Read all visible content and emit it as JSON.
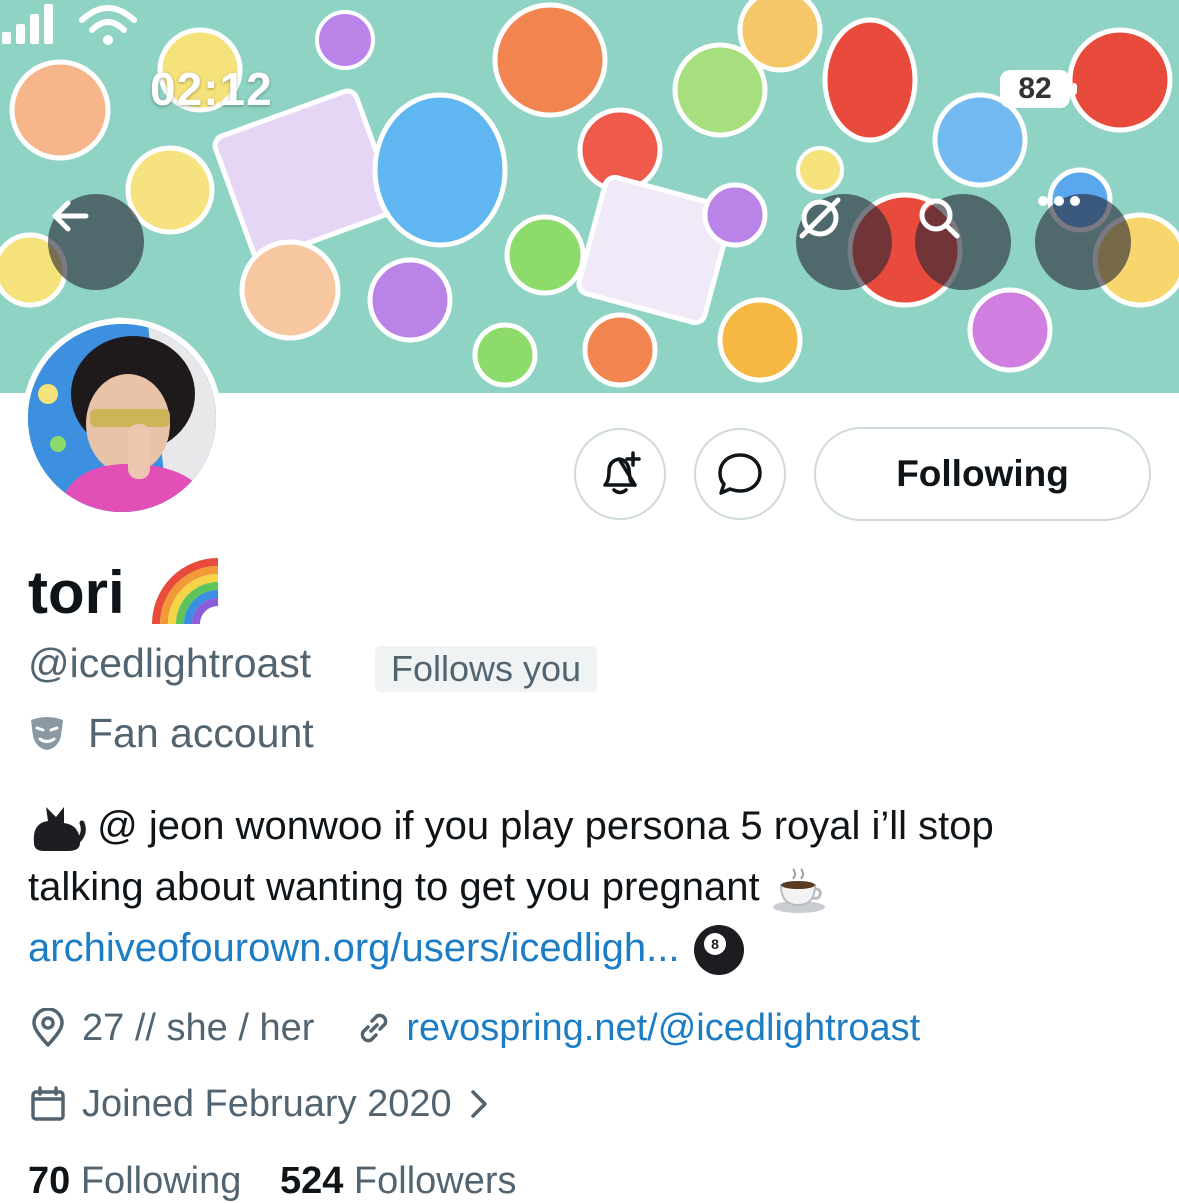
{
  "status_bar": {
    "time": "02:12",
    "battery": "82"
  },
  "header": {
    "back_icon": "arrow-left-icon",
    "grok_icon": "grok-icon",
    "search_icon": "search-icon",
    "more_icon": "more-dots-icon"
  },
  "profile": {
    "name": "tori",
    "name_emoji": "rainbow",
    "handle": "@icedlightroast",
    "follows_you_badge": "Follows you",
    "category": "Fan account",
    "bio_line1": "@ jeon wonwoo if you play persona 5 royal i’ll stop",
    "bio_line2": "talking about wanting to get you pregnant",
    "bio_link": "archiveofourown.org/users/icedligh...",
    "location": "27 // she / her",
    "website": "revospring.net/@icedlightroast",
    "joined": "Joined February 2020"
  },
  "actions": {
    "notify_icon": "bell-plus-icon",
    "message_icon": "message-bubble-icon",
    "following_label": "Following"
  },
  "stats": {
    "following_count": "70",
    "following_label": "Following",
    "followers_count": "524",
    "followers_label": "Followers"
  },
  "colors": {
    "link": "#1d7dc4",
    "secondary_text": "#536471",
    "border": "#cfd9de"
  }
}
